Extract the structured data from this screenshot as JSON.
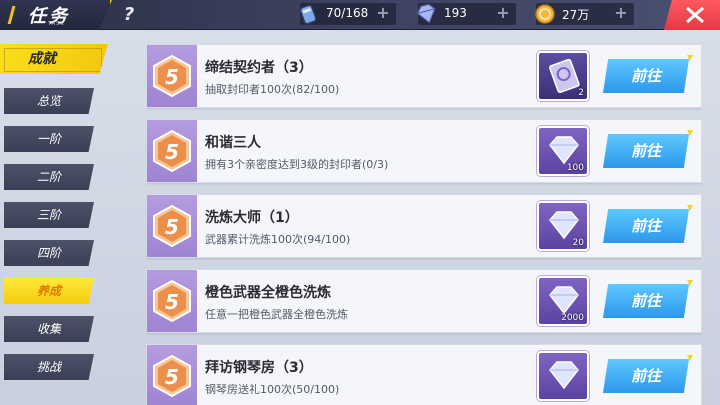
{
  "header": {
    "title": "任务",
    "subtitle": "TASK",
    "help": "?",
    "resources": [
      {
        "icon": "energy-canister-icon",
        "value": "70/168"
      },
      {
        "icon": "diamond-icon",
        "value": "193"
      },
      {
        "icon": "coin-icon",
        "value": "27万"
      }
    ],
    "plus": "+"
  },
  "sidebar": {
    "category": "成就",
    "items": [
      {
        "label": "总览",
        "active": false
      },
      {
        "label": "一阶",
        "active": false
      },
      {
        "label": "二阶",
        "active": false
      },
      {
        "label": "三阶",
        "active": false
      },
      {
        "label": "四阶",
        "active": false
      },
      {
        "label": "养成",
        "active": true
      },
      {
        "label": "收集",
        "active": false
      },
      {
        "label": "挑战",
        "active": false
      }
    ]
  },
  "tasks": [
    {
      "level": "5",
      "title": "缔结契约者（3）",
      "desc": "抽取封印者100次(82/100)",
      "reward_icon": "contract-card-icon",
      "reward_count": "2",
      "button": "前往"
    },
    {
      "level": "5",
      "title": "和谐三人",
      "desc": "拥有3个亲密度达到3级的封印者(0/3)",
      "reward_icon": "diamond-icon",
      "reward_count": "100",
      "button": "前往"
    },
    {
      "level": "5",
      "title": "洗炼大师（1）",
      "desc": "武器累计洗炼100次(94/100)",
      "reward_icon": "diamond-icon",
      "reward_count": "20",
      "button": "前往"
    },
    {
      "level": "5",
      "title": "橙色武器全橙色洗炼",
      "desc": "任意一把橙色武器全橙色洗炼",
      "reward_icon": "diamond-icon",
      "reward_count": "2000",
      "button": "前往"
    },
    {
      "level": "5",
      "title": "拜访钢琴房（3）",
      "desc": "钢琴房送礼100次(50/100)",
      "reward_icon": "diamond-icon",
      "reward_count": "",
      "button": "前往"
    }
  ],
  "colors": {
    "accent_yellow": "#f4cc10",
    "button_blue": "#2c98ea",
    "badge_purple": "#9f84d2",
    "close_red": "#e23a45"
  }
}
